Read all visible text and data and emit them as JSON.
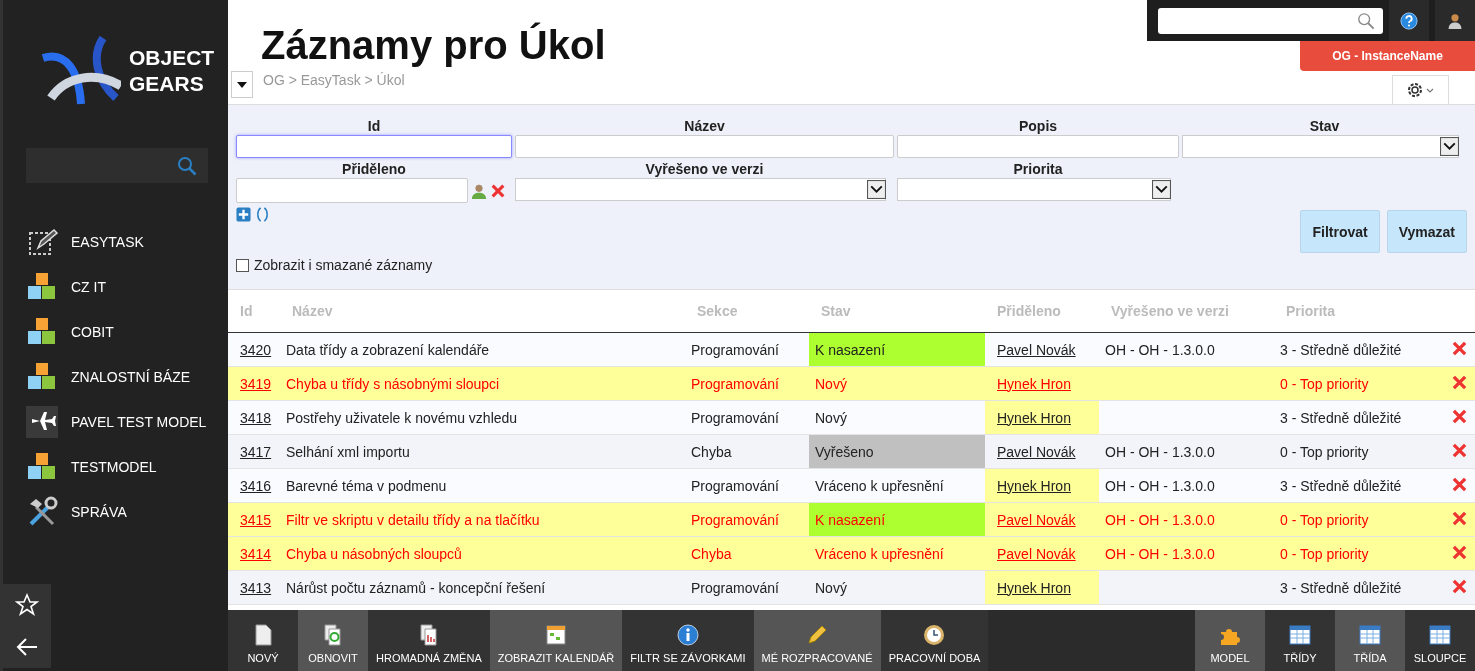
{
  "sidebar": {
    "logo": {
      "line1": "OBJECT",
      "line2": "GEARS"
    },
    "items": [
      {
        "label": "EASYTASK",
        "kind": "note"
      },
      {
        "label": "CZ IT",
        "kind": "cubes"
      },
      {
        "label": "COBIT",
        "kind": "cubes"
      },
      {
        "label": "ZNALOSTNÍ BÁZE",
        "kind": "cubes"
      },
      {
        "label": "PAVEL TEST MODEL",
        "kind": "plane"
      },
      {
        "label": "TESTMODEL",
        "kind": "cubes"
      },
      {
        "label": "SPRÁVA",
        "kind": "tools"
      }
    ]
  },
  "header": {
    "title": "Záznamy pro Úkol",
    "breadcrumb": "OG > EasyTask > Úkol",
    "instance": "OG - InstanceName"
  },
  "filter": {
    "fields": [
      {
        "label": "Id",
        "kind": "text",
        "focused": true
      },
      {
        "label": "Název",
        "kind": "text",
        "focused": false
      },
      {
        "label": "Popis",
        "kind": "text",
        "focused": false
      },
      {
        "label": "Stav",
        "kind": "select",
        "focused": false
      },
      {
        "label": "Přiděleno",
        "kind": "person",
        "focused": false
      },
      {
        "label": "Vyřešeno ve verzi",
        "kind": "select",
        "focused": false
      },
      {
        "label": "Priorita",
        "kind": "select",
        "focused": false
      }
    ],
    "buttons": [
      "Filtrovat",
      "Vymazat"
    ],
    "show_deleted": {
      "label": "Zobrazit i smazané záznamy",
      "checked": false
    }
  },
  "table": {
    "columns": [
      "Id",
      "Název",
      "Sekce",
      "Stav",
      "Přiděleno",
      "Vyřešeno ve verzi",
      "Priorita"
    ],
    "rows": [
      {
        "id": "3420",
        "name": "Data třídy a zobrazení kalendáře",
        "section": "Programování",
        "status": {
          "text": "K nasazení",
          "color": "#adff2f"
        },
        "assignee": {
          "name": "Pavel Novák",
          "highlighted": false
        },
        "version": "OH - OH - 1.3.0.0",
        "priority": "3 - Středně důležité",
        "highlighted": false
      },
      {
        "id": "3419",
        "name": "Chyba u třídy s násobnými sloupci",
        "section": "Programování",
        "status": {
          "text": "Nový"
        },
        "assignee": {
          "name": "Hynek Hron",
          "highlighted": true
        },
        "version": "",
        "priority": "0 - Top priority",
        "highlighted": true
      },
      {
        "id": "3418",
        "name": "Postřehy uživatele k novému vzhledu",
        "section": "Programování",
        "status": {
          "text": "Nový"
        },
        "assignee": {
          "name": "Hynek Hron",
          "highlighted": true
        },
        "version": "",
        "priority": "3 - Středně důležité",
        "highlighted": false
      },
      {
        "id": "3417",
        "name": "Selhání xml importu",
        "section": "Chyba",
        "status": {
          "text": "Vyřešeno",
          "color": "#c0c0c0"
        },
        "assignee": {
          "name": "Pavel Novák",
          "highlighted": false
        },
        "version": "OH - OH - 1.3.0.0",
        "priority": "0 - Top priority",
        "highlighted": false
      },
      {
        "id": "3416",
        "name": "Barevné téma v podmenu",
        "section": "Programování",
        "status": {
          "text": "Vráceno k upřesnění"
        },
        "assignee": {
          "name": "Hynek Hron",
          "highlighted": true
        },
        "version": "OH - OH - 1.3.0.0",
        "priority": "3 - Středně důležité",
        "highlighted": false
      },
      {
        "id": "3415",
        "name": "Filtr ve skriptu v detailu třídy a na tlačítku",
        "section": "Programování",
        "status": {
          "text": "K nasazení",
          "color": "#adff2f"
        },
        "assignee": {
          "name": "Pavel Novák",
          "highlighted": true
        },
        "version": "OH - OH - 1.3.0.0",
        "priority": "0 - Top priority",
        "highlighted": true
      },
      {
        "id": "3414",
        "name": "Chyba u násobných sloupců",
        "section": "Chyba",
        "status": {
          "text": "Vráceno k upřesnění"
        },
        "assignee": {
          "name": "Pavel Novák",
          "highlighted": true
        },
        "version": "OH - OH - 1.3.0.0",
        "priority": "0 - Top priority",
        "highlighted": true
      },
      {
        "id": "3413",
        "name": "Nárůst počtu záznamů - koncepční řešení",
        "section": "Programování",
        "status": {
          "text": "Nový"
        },
        "assignee": {
          "name": "Hynek Hron",
          "highlighted": true
        },
        "version": "",
        "priority": "3 - Středně důležité",
        "highlighted": false
      }
    ]
  },
  "toolbar": {
    "left": [
      {
        "label": "NOVÝ",
        "kind": "page"
      },
      {
        "label": "OBNOVIT",
        "kind": "refresh"
      },
      {
        "label": "HROMADNÁ ZMĚNA",
        "kind": "pages"
      },
      {
        "label": "ZOBRAZIT KALENDÁŘ",
        "kind": "calendar"
      },
      {
        "label": "FILTR SE ZÁVORKAMI",
        "kind": "info"
      },
      {
        "label": "MÉ ROZPRACOVANÉ",
        "kind": "pencil"
      },
      {
        "label": "PRACOVNÍ DOBA",
        "kind": "clock"
      }
    ],
    "right": [
      {
        "label": "MODEL",
        "kind": "puzzle"
      },
      {
        "label": "TŘÍDY",
        "kind": "table"
      },
      {
        "label": "TŘÍDA",
        "kind": "table"
      },
      {
        "label": "SLOUPCE",
        "kind": "table"
      }
    ]
  }
}
